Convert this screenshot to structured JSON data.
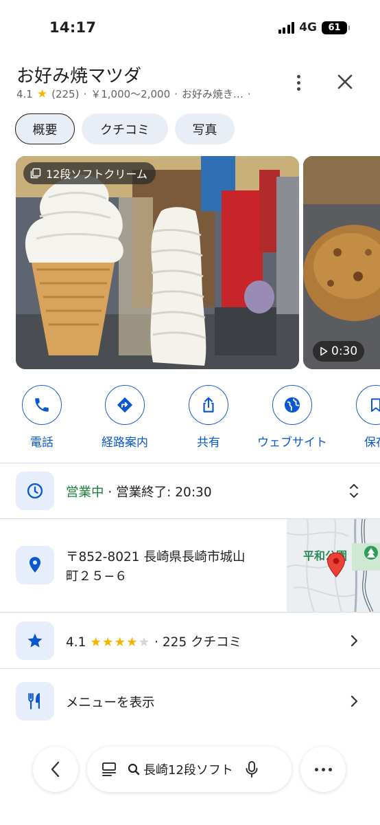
{
  "status_bar": {
    "time": "14:17",
    "network": "4G",
    "battery": "61"
  },
  "place": {
    "name": "お好み焼マツダ",
    "rating": "4.1",
    "review_count": "(225)",
    "price": "￥1,000～2,000",
    "category": "お好み焼き…",
    "separator": "·"
  },
  "tabs": [
    {
      "label": "概要",
      "active": true
    },
    {
      "label": "クチコミ",
      "active": false
    },
    {
      "label": "写真",
      "active": false
    }
  ],
  "photos": {
    "main_label": "12段ソフトクリーム",
    "video_duration": "0:30"
  },
  "actions": [
    {
      "label": "電話",
      "icon": "phone-icon"
    },
    {
      "label": "経路案内",
      "icon": "directions-icon"
    },
    {
      "label": "共有",
      "icon": "share-icon"
    },
    {
      "label": "ウェブサイト",
      "icon": "globe-icon"
    },
    {
      "label": "保存",
      "icon": "bookmark-icon"
    }
  ],
  "hours": {
    "status": "営業中",
    "detail": "· 営業終了: 20:30"
  },
  "address": {
    "line1": "〒852-8021 長崎県長崎市城山",
    "line2": "町２５−６",
    "map_label": "平和公園"
  },
  "reviews_row": {
    "rating": "4.1",
    "stars_filled": 4,
    "count_text": "· 225 クチコミ"
  },
  "menu_row": {
    "label": "メニューを表示"
  },
  "bottom_bar": {
    "search_text": "長崎12段ソフト"
  },
  "colors": {
    "accent": "#0b57d0",
    "open": "#188038",
    "star": "#f5b400",
    "icon_bg": "#e7eefb"
  }
}
